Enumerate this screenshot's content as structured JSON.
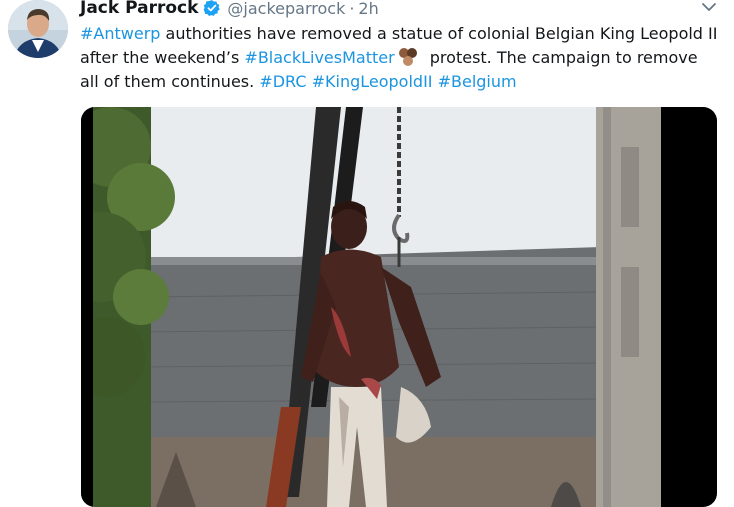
{
  "tweet": {
    "author_name": "Jack Parrock",
    "author_handle": "@jackeparrock",
    "separator": "·",
    "timestamp": "2h",
    "text": {
      "hashtag_antwerp": "#Antwerp",
      "part1": " authorities have removed a statue of colonial Belgian King Leopold II after the weekend’s ",
      "hashtag_blm": "#BlackLivesMatter",
      "part2": " protest. The campaign to remove all of them continues. ",
      "hashtag_drc": "#DRC",
      "hashtag_kingleopold": "#KingLeopoldII",
      "hashtag_belgium": "#Belgium"
    }
  },
  "icons": {
    "verified": "verified-badge-icon",
    "more": "chevron-down-icon",
    "hashtag_emoji": "black-lives-matter-fists-emoji"
  },
  "colors": {
    "link": "#1b95e0",
    "verified": "#1da1f2",
    "secondary_text": "#657786"
  }
}
